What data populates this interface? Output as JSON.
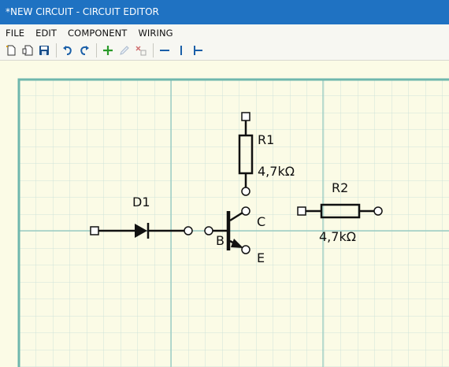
{
  "window": {
    "title": "*NEW CIRCUIT - CIRCUIT EDITOR"
  },
  "menu": {
    "file": "FILE",
    "edit": "EDIT",
    "component": "COMPONENT",
    "wiring": "WIRING"
  },
  "toolbar": {
    "icons": [
      "new-file-icon",
      "open-file-icon",
      "save-icon",
      "undo-icon",
      "redo-icon",
      "add-icon",
      "edit-icon",
      "delete-icon",
      "horizontal-wire-icon",
      "vertical-wire-icon",
      "junction-icon"
    ]
  },
  "circuit": {
    "r1": {
      "name": "R1",
      "value": "4,7kΩ"
    },
    "r2": {
      "name": "R2",
      "value": "4,7kΩ"
    },
    "d1": {
      "name": "D1"
    },
    "q1": {
      "base": "B",
      "collector": "C",
      "emitter": "E"
    }
  },
  "colors": {
    "titlebar": "#1f72c2",
    "canvas": "#fbfbe6",
    "grid_minor": "#cfe3d9",
    "grid_major": "#8fc7bf"
  }
}
